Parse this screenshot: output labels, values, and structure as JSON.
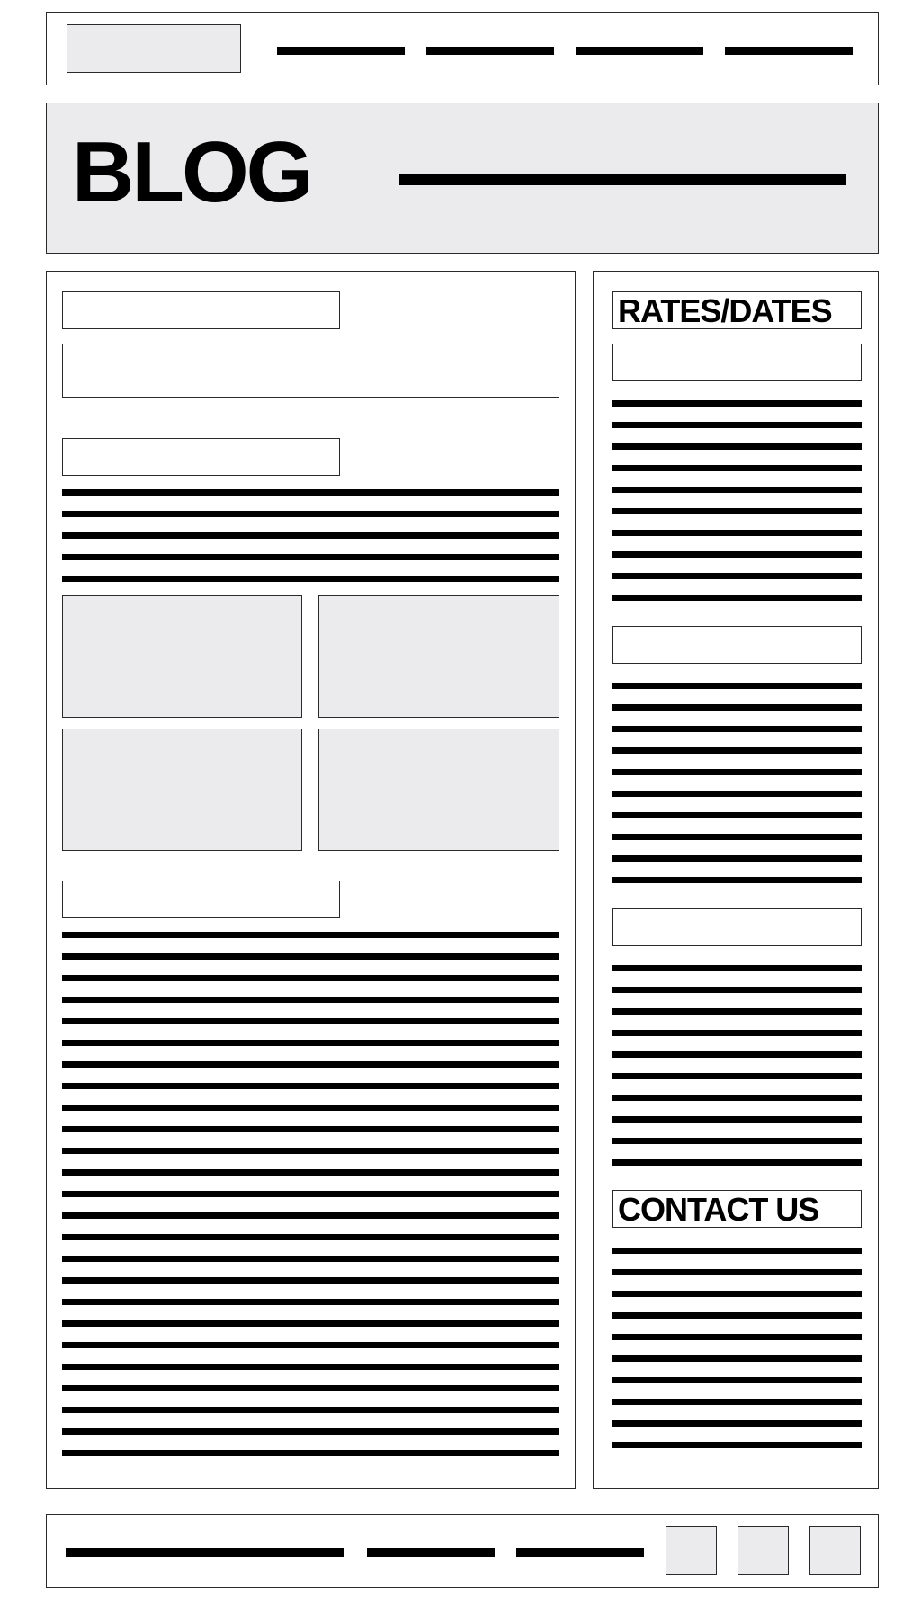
{
  "header": {
    "title": "BLOG"
  },
  "sidebar": {
    "rates_heading": "RATES/DATES",
    "contact_heading": "CONTACT US"
  },
  "colors": {
    "placeholder_fill": "#ebebed",
    "line": "#000000",
    "border": "#2a2a2a"
  }
}
